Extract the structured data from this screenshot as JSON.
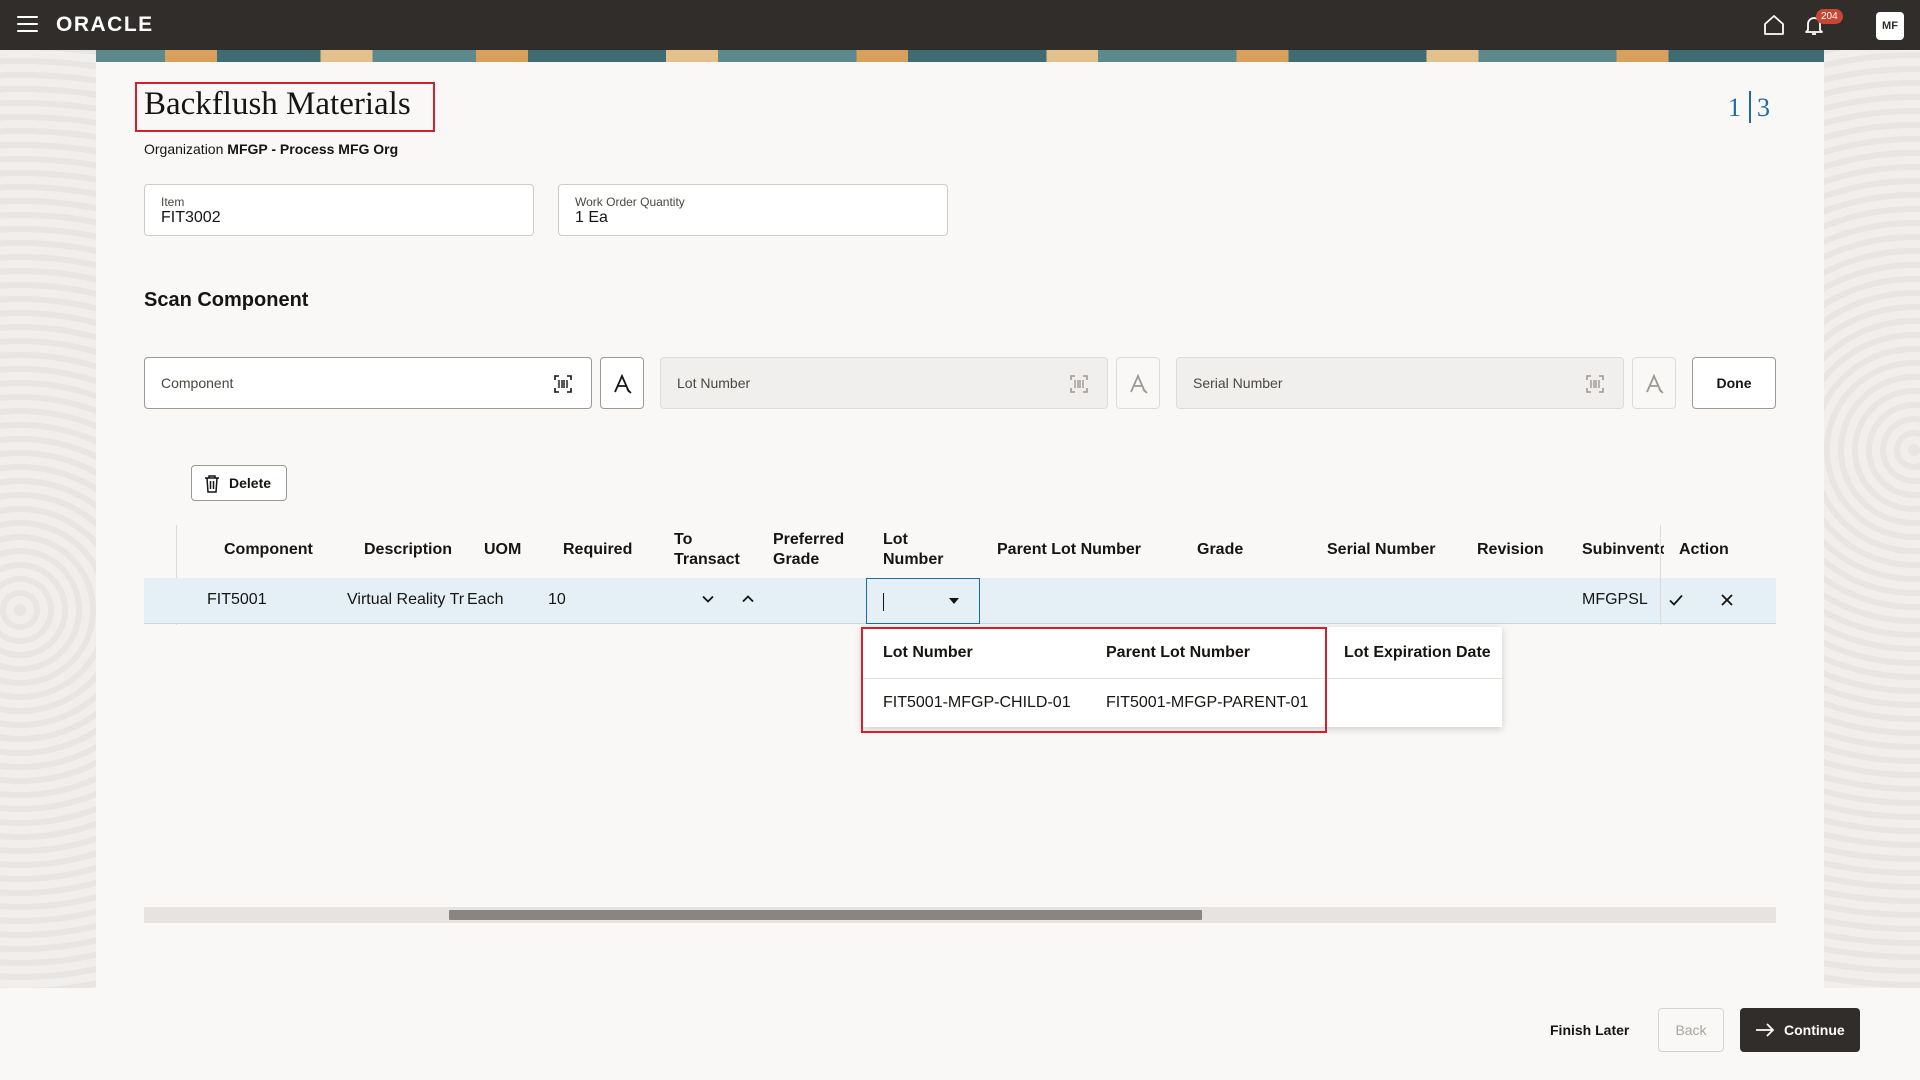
{
  "header": {
    "logo": "ORACLE",
    "notification_count": "204",
    "avatar_initials": "MF"
  },
  "page": {
    "title": "Backflush Materials",
    "org_label": "Organization",
    "org_value": "MFGP - Process MFG Org",
    "step_current": "1",
    "step_total": "3"
  },
  "fields": {
    "item_label": "Item",
    "item_value": "FIT3002",
    "woq_label": "Work Order Quantity",
    "woq_value": "1 Ea"
  },
  "scan": {
    "title": "Scan Component",
    "component_placeholder": "Component",
    "lot_placeholder": "Lot Number",
    "serial_placeholder": "Serial Number",
    "done_label": "Done"
  },
  "table": {
    "delete_label": "Delete",
    "headers": {
      "component": "Component",
      "description": "Description",
      "uom": "UOM",
      "required": "Required",
      "to_transact_1": "To",
      "to_transact_2": "Transact",
      "preferred_grade_1": "Preferred",
      "preferred_grade_2": "Grade",
      "lot_number_1": "Lot",
      "lot_number_2": "Number",
      "parent_lot_number": "Parent Lot Number",
      "grade": "Grade",
      "serial_number": "Serial Number",
      "revision": "Revision",
      "subinventory": "Subinvento",
      "action": "Action"
    },
    "rows": [
      {
        "component": "FIT5001",
        "description": "Virtual Reality Tr",
        "uom": "Each",
        "required": "10",
        "subinventory": "MFGPSL"
      }
    ]
  },
  "lot_dropdown": {
    "headers": {
      "lot_number": "Lot Number",
      "parent_lot_number": "Parent Lot Number",
      "lot_expiration_date": "Lot Expiration Date"
    },
    "rows": [
      {
        "lot_number": "FIT5001-MFGP-CHILD-01",
        "parent_lot_number": "FIT5001-MFGP-PARENT-01",
        "lot_expiration_date": ""
      }
    ]
  },
  "footer": {
    "finish_later": "Finish Later",
    "back": "Back",
    "continue": "Continue"
  },
  "colors": {
    "header_bg": "#312d2a",
    "accent_blue": "#1f6ba0",
    "highlight_red": "#d4202c",
    "badge_red": "#c74634",
    "selected_row": "#e4f0f6"
  },
  "icons": [
    "menu-icon",
    "home-icon",
    "bell-icon",
    "barcode-scan-icon",
    "keyboard-a-icon",
    "trash-icon",
    "chevron-down-icon",
    "chevron-up-icon",
    "check-icon",
    "close-icon",
    "arrow-right-icon"
  ]
}
